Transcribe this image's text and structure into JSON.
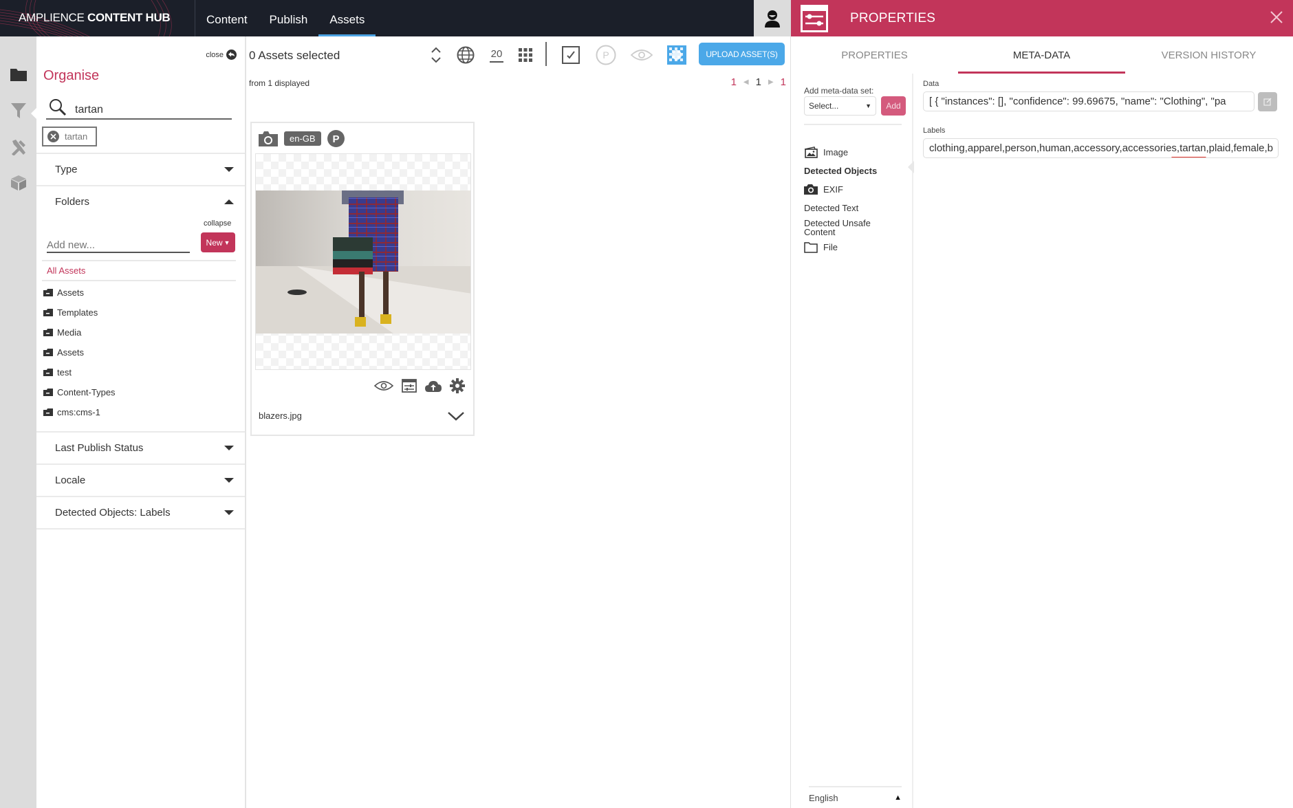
{
  "app": {
    "brand_light": "AMPLIENCE ",
    "brand_bold": "CONTENT HUB",
    "accent_color": "#c2355a",
    "nav": [
      {
        "label": "Content",
        "active": false
      },
      {
        "label": "Publish",
        "active": false
      },
      {
        "label": "Assets",
        "active": true
      }
    ],
    "user_icon": "user-avatar-icon"
  },
  "rail": {
    "icons": [
      "folder-icon",
      "filter-icon",
      "tools-icon",
      "cube-icon"
    ],
    "active": "folder-icon"
  },
  "organise": {
    "close_label": "close",
    "title": "Organise",
    "search_value": "tartan",
    "chips": [
      "tartan"
    ],
    "sections": {
      "type": "Type",
      "folders": "Folders",
      "last_publish_status": "Last Publish Status",
      "locale": "Locale",
      "detected_objects_labels": "Detected Objects: Labels"
    },
    "collapse_label": "collapse",
    "add_new_placeholder": "Add new...",
    "new_button": "New",
    "all_assets": "All Assets",
    "folders": [
      "Assets",
      "Templates",
      "Media",
      "Assets",
      "test",
      "Content-Types",
      "cms:cms-1"
    ]
  },
  "assets": {
    "selected_text": "0 Assets selected",
    "displayed_text": "from 1 displayed",
    "page_size": "20",
    "upload_label": "UPLOAD ASSET(S)",
    "pager": {
      "first": "1",
      "current": "1",
      "last": "1"
    },
    "toolbar_icons": [
      "sort-icon",
      "globe-icon",
      "page-size-icon",
      "grid-icon",
      "select-all-icon",
      "publish-icon",
      "preview-icon",
      "transparency-icon"
    ],
    "card": {
      "locale": "en-GB",
      "type_icon": "camera-icon",
      "status_icon": "published-icon",
      "filename": "blazers.jpg",
      "actions": [
        "preview-icon",
        "properties-icon",
        "upload-icon",
        "settings-icon"
      ]
    }
  },
  "properties": {
    "title": "PROPERTIES",
    "tabs": [
      {
        "label": "PROPERTIES",
        "active": false
      },
      {
        "label": "META-DATA",
        "active": true
      },
      {
        "label": "VERSION HISTORY",
        "active": false
      }
    ],
    "add_set_label": "Add meta-data set:",
    "select_value": "Select...",
    "add_button": "Add",
    "side_items": [
      {
        "label": "Image",
        "icon": "image-icon",
        "bold": false
      },
      {
        "label": "Detected Objects",
        "icon": "",
        "bold": true
      },
      {
        "label": "EXIF",
        "icon": "camera-icon",
        "bold": false
      },
      {
        "label": "Detected Text",
        "icon": "",
        "bold": false
      },
      {
        "label": "Detected Unsafe Content",
        "icon": "",
        "bold": false
      },
      {
        "label": "File",
        "icon": "folder-outline-icon",
        "bold": false
      }
    ],
    "language": "English",
    "data_label": "Data",
    "data_value": "[ {   \"instances\": [],   \"confidence\": 99.69675,   \"name\": \"Clothing\",   \"pa",
    "labels_label": "Labels",
    "labels_before": "clothing,apparel,person,human,accessory,accessorie",
    "labels_highlight": "s,tartan",
    "labels_after": ",plaid,female,b"
  }
}
